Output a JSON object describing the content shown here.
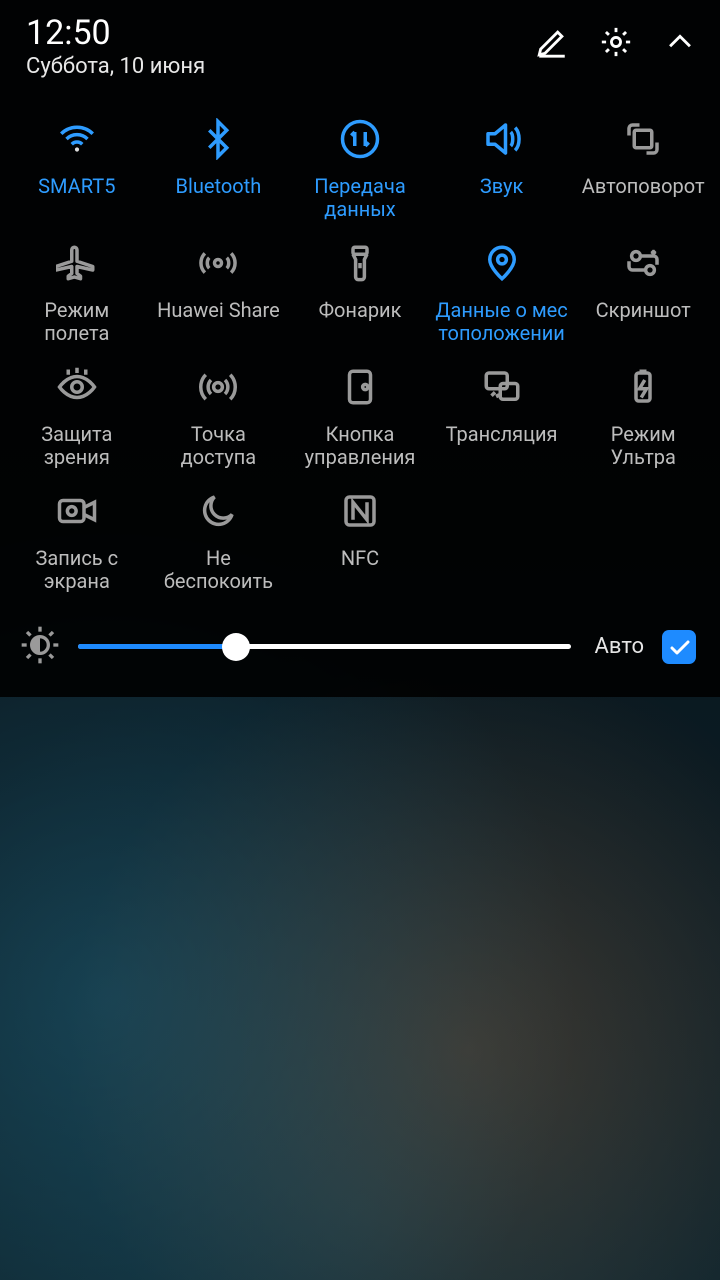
{
  "header": {
    "time": "12:50",
    "date": "Суббота, 10 июня"
  },
  "tiles": [
    {
      "id": "wifi",
      "label": "SMART5",
      "active": true
    },
    {
      "id": "bluetooth",
      "label": "Bluetooth",
      "active": true
    },
    {
      "id": "data",
      "label": "Передача данных",
      "active": true
    },
    {
      "id": "sound",
      "label": "Звук",
      "active": true
    },
    {
      "id": "rotate",
      "label": "Автоповорот",
      "active": false
    },
    {
      "id": "airplane",
      "label": "Режим полета",
      "active": false
    },
    {
      "id": "hshare",
      "label": "Huawei Share",
      "active": false
    },
    {
      "id": "flashlight",
      "label": "Фонарик",
      "active": false
    },
    {
      "id": "location",
      "label": "Данные о мес тоположении",
      "active": true
    },
    {
      "id": "screenshot",
      "label": "Скриншот",
      "active": false
    },
    {
      "id": "eyecomfort",
      "label": "Защита зрения",
      "active": false
    },
    {
      "id": "hotspot",
      "label": "Точка доступа",
      "active": false
    },
    {
      "id": "navbtn",
      "label": "Кнопка управления",
      "active": false
    },
    {
      "id": "cast",
      "label": "Трансляция",
      "active": false
    },
    {
      "id": "ultra",
      "label": "Режим Ультра",
      "active": false
    },
    {
      "id": "screenrec",
      "label": "Запись с экрана",
      "active": false
    },
    {
      "id": "dnd",
      "label": "Не беспокоить",
      "active": false
    },
    {
      "id": "nfc",
      "label": "NFC",
      "active": false
    }
  ],
  "brightness": {
    "percent": 32,
    "auto_label": "Авто",
    "auto_checked": true
  },
  "colors": {
    "accent": "#1e8bff"
  }
}
